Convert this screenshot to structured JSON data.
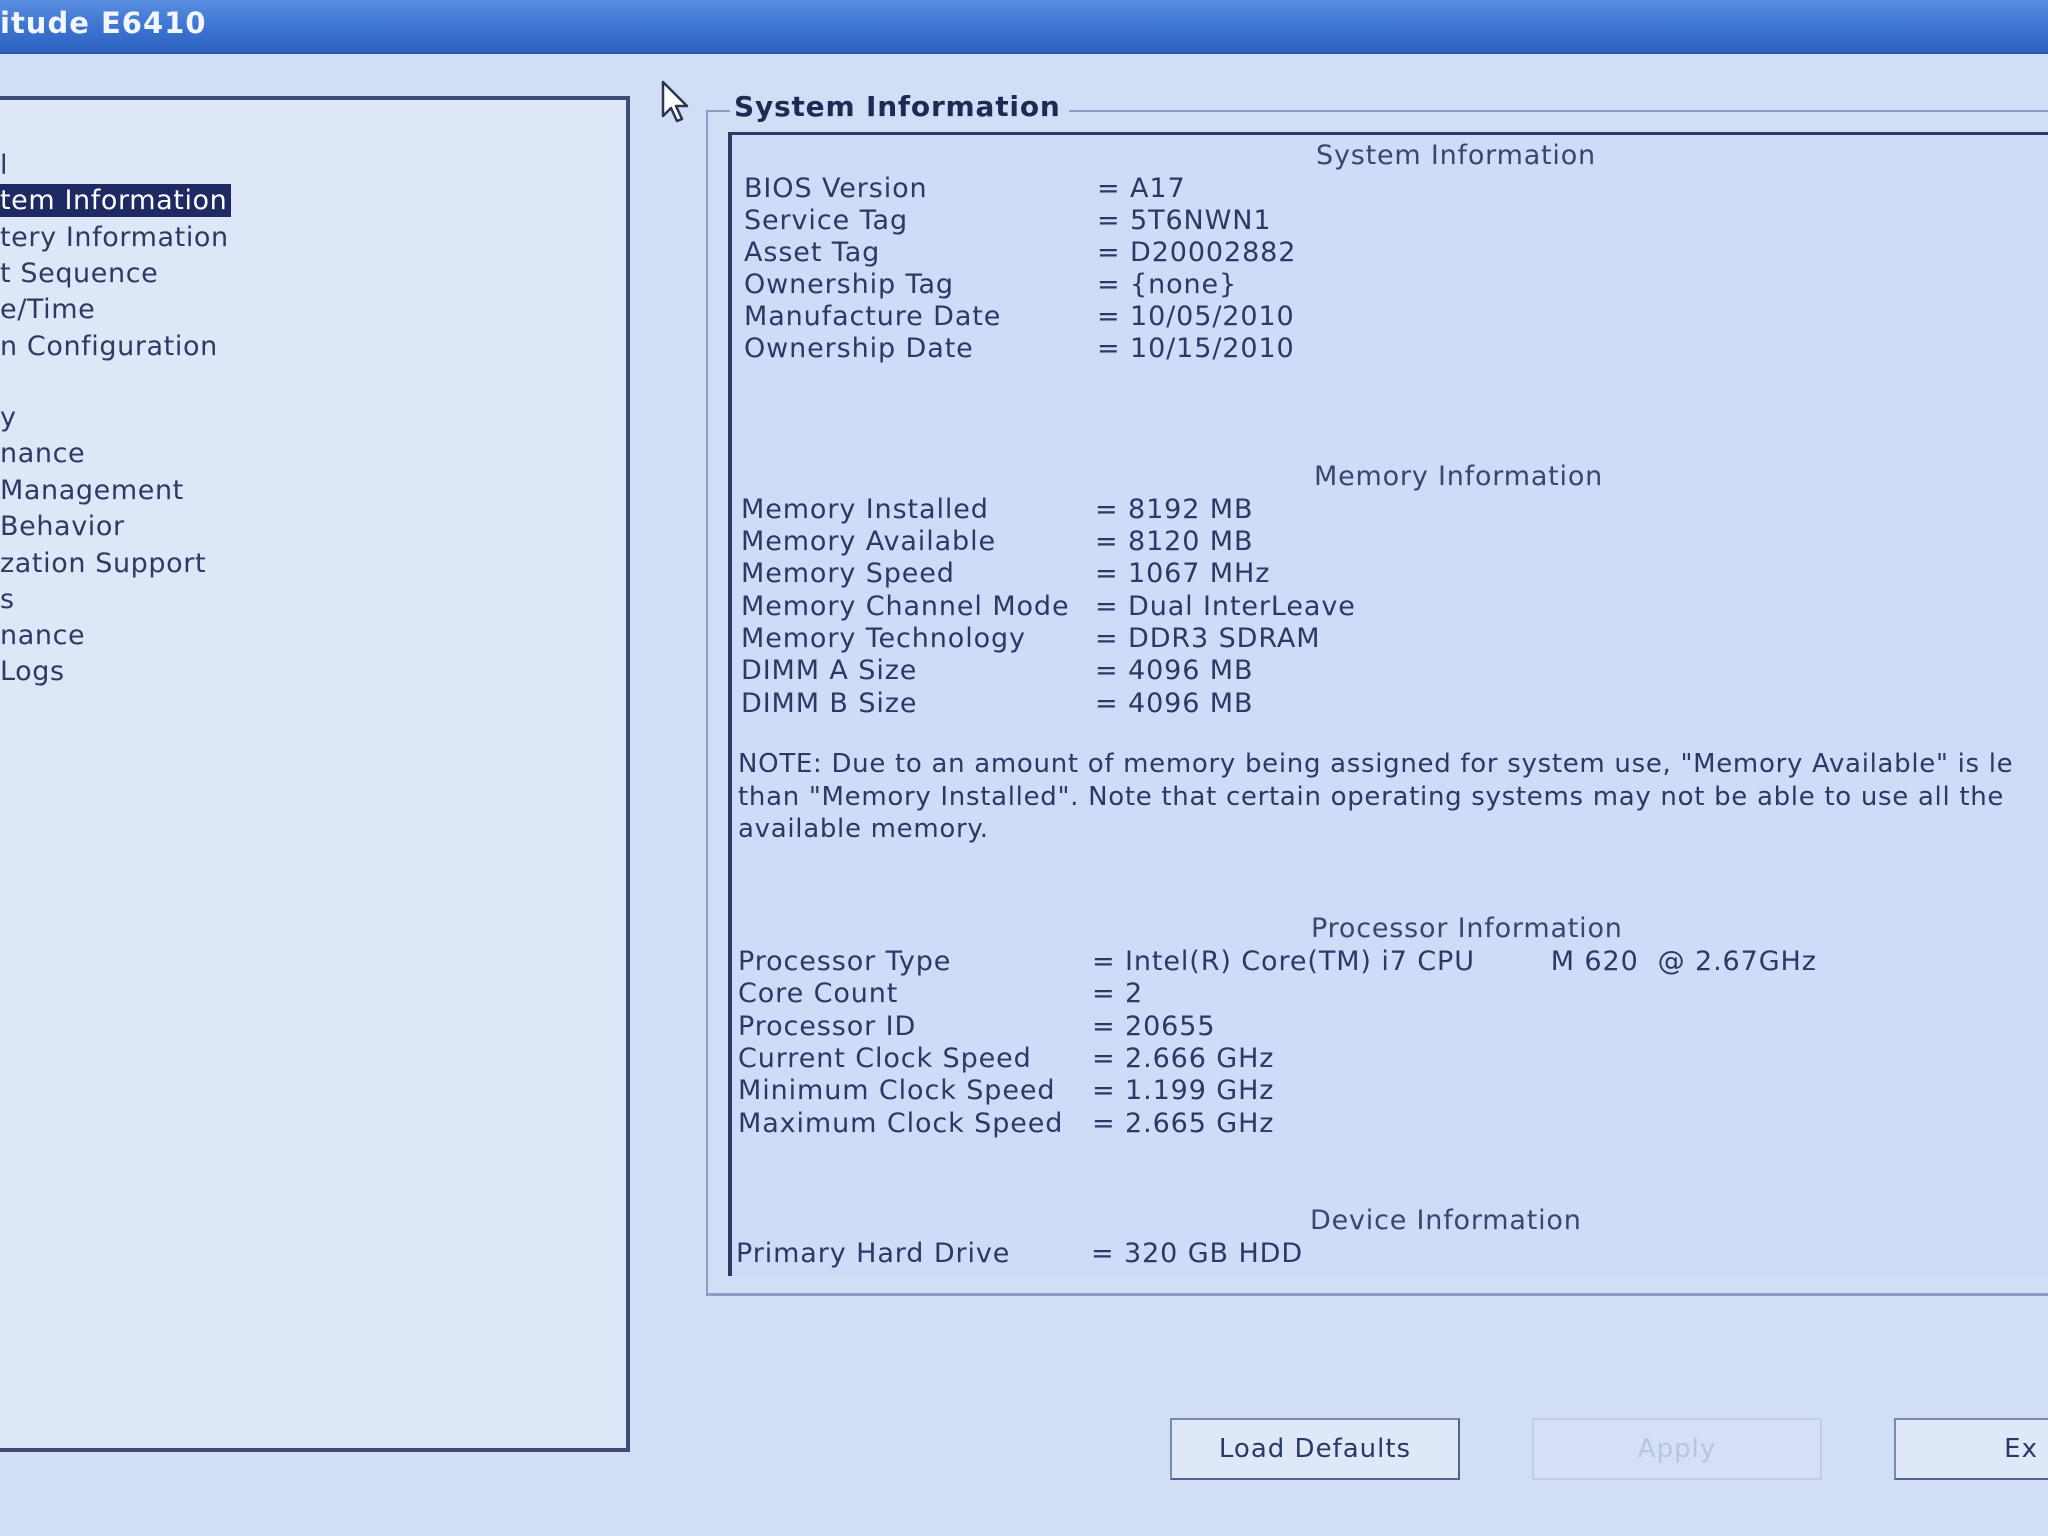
{
  "window": {
    "title": "itude E6410"
  },
  "nav": {
    "items": [
      {
        "label": "l",
        "selected": false
      },
      {
        "label": "tem Information",
        "selected": true
      },
      {
        "label": "tery Information",
        "selected": false
      },
      {
        "label": "t Sequence",
        "selected": false
      },
      {
        "label": "e/Time",
        "selected": false
      },
      {
        "label": "n Configuration",
        "selected": false
      },
      {
        "label": "y",
        "selected": false
      },
      {
        "label": "nance",
        "selected": false
      },
      {
        "label": "Management",
        "selected": false
      },
      {
        "label": "Behavior",
        "selected": false
      },
      {
        "label": "zation Support",
        "selected": false
      },
      {
        "label": "s",
        "selected": false
      },
      {
        "label": "nance",
        "selected": false
      },
      {
        "label": "Logs",
        "selected": false
      }
    ]
  },
  "panel": {
    "group_title": "System Information",
    "system": {
      "heading": "System Information",
      "rows": [
        {
          "label": "BIOS Version",
          "value": "= A17"
        },
        {
          "label": "Service Tag",
          "value": "= 5T6NWN1"
        },
        {
          "label": "Asset Tag",
          "value": "= D20002882"
        },
        {
          "label": "Ownership Tag",
          "value": "= {none}"
        },
        {
          "label": "Manufacture Date",
          "value": "= 10/05/2010"
        },
        {
          "label": "Ownership Date",
          "value": "= 10/15/2010"
        }
      ]
    },
    "memory": {
      "heading": "Memory Information",
      "rows": [
        {
          "label": "Memory Installed",
          "value": "= 8192 MB"
        },
        {
          "label": "Memory Available",
          "value": "= 8120 MB"
        },
        {
          "label": "Memory Speed",
          "value": "= 1067 MHz"
        },
        {
          "label": "Memory Channel Mode",
          "value": "= Dual InterLeave"
        },
        {
          "label": "Memory Technology",
          "value": "= DDR3 SDRAM"
        },
        {
          "label": "DIMM A Size",
          "value": "= 4096 MB"
        },
        {
          "label": "DIMM B Size",
          "value": "= 4096 MB"
        }
      ],
      "note_lines": [
        "NOTE: Due to an amount of memory being assigned for system use, \"Memory Available\" is le",
        "than \"Memory Installed\". Note that certain operating systems may not be able to use all the",
        "available memory."
      ]
    },
    "processor": {
      "heading": "Processor Information",
      "rows": [
        {
          "label": "Processor Type",
          "value": "= Intel(R) Core(TM) i7 CPU        M 620  @ 2.67GHz"
        },
        {
          "label": "Core Count",
          "value": "= 2"
        },
        {
          "label": "Processor ID",
          "value": "= 20655"
        },
        {
          "label": "Current Clock Speed",
          "value": "= 2.666 GHz"
        },
        {
          "label": "Minimum Clock Speed",
          "value": "= 1.199 GHz"
        },
        {
          "label": "Maximum Clock Speed",
          "value": "= 2.665 GHz"
        }
      ]
    },
    "device": {
      "heading": "Device Information",
      "rows": [
        {
          "label": "Primary Hard Drive",
          "value": "= 320 GB HDD"
        }
      ]
    }
  },
  "buttons": {
    "load_defaults": "Load Defaults",
    "apply": "Apply",
    "exit": "Ex"
  },
  "icons": {
    "cursor": "mouse-pointer-icon"
  }
}
